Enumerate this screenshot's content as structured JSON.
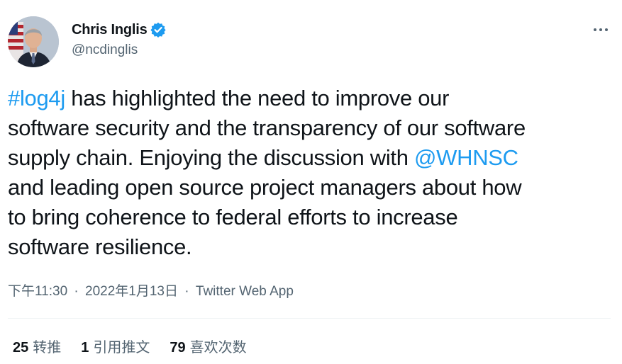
{
  "author": {
    "display_name": "Chris Inglis",
    "handle": "@ncdinglis",
    "verified": true
  },
  "tweet": {
    "lines": [
      [
        {
          "text": "#log4j",
          "link": true
        },
        {
          "text": " has highlighted the need to improve our",
          "link": false
        }
      ],
      [
        {
          "text": "software security and the transparency of our software",
          "link": false
        }
      ],
      [
        {
          "text": "supply chain. Enjoying the discussion with ",
          "link": false
        },
        {
          "text": "@WHNSC",
          "link": true
        }
      ],
      [
        {
          "text": "and leading open source project managers about how",
          "link": false
        }
      ],
      [
        {
          "text": "to bring coherence to federal efforts to increase",
          "link": false
        }
      ],
      [
        {
          "text": "software resilience.",
          "link": false
        }
      ]
    ]
  },
  "meta": {
    "time": "下午11:30",
    "separator": "·",
    "date": "2022年1月13日",
    "source": "Twitter Web App"
  },
  "stats": {
    "retweets_count": "25",
    "retweets_label": "转推",
    "quotes_count": "1",
    "quotes_label": "引用推文",
    "likes_count": "79",
    "likes_label": "喜欢次数"
  },
  "colors": {
    "link": "#1d9bf0",
    "text": "#0f1419",
    "secondary": "#536471",
    "divider": "#eff3f4"
  },
  "icons": {
    "verified": "verified-badge-icon",
    "more": "more-options-icon"
  }
}
